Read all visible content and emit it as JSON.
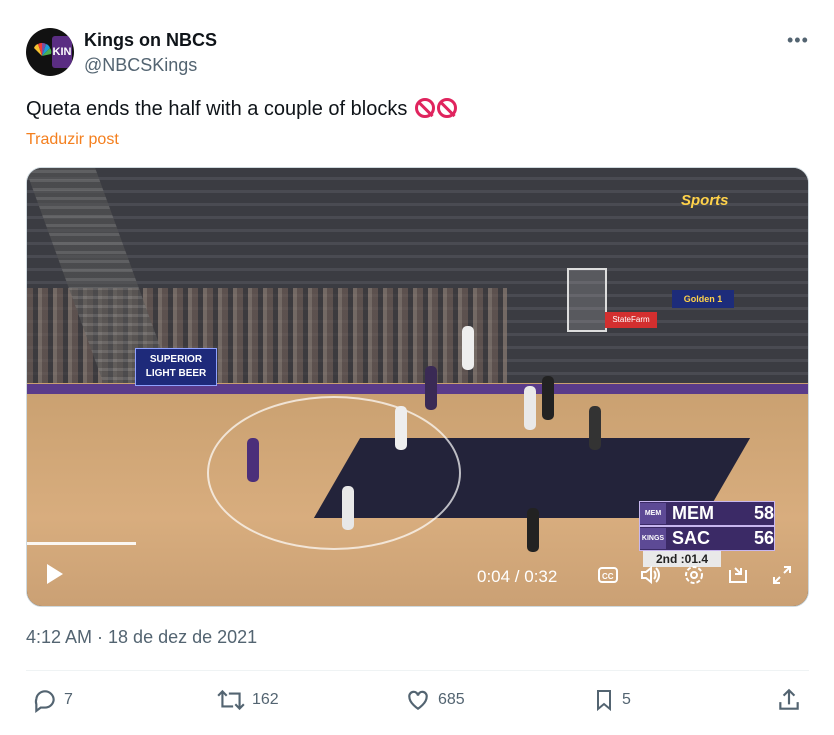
{
  "author": {
    "name": "Kings on NBCS",
    "handle": "@NBCSKings",
    "avatar_text": "KIN"
  },
  "post": {
    "text": "Queta ends the half with a couple of blocks",
    "emoji": [
      "🚫",
      "🚫"
    ],
    "translate_label": "Traduzir post",
    "timestamp": "4:12 AM · 18 de dez de 2021"
  },
  "video": {
    "current_time": "0:04",
    "duration": "0:32",
    "time_label": "0:04 / 0:32",
    "progress": 0.14,
    "broadcaster": "Sports",
    "arena_sign": "SUPERIOR LIGHT BEER",
    "golden_sign": "Golden 1",
    "sf_sign": "StateFarm",
    "scoreboard": {
      "teams": [
        {
          "abbr": "MEM",
          "score": "58",
          "logo": "MEM"
        },
        {
          "abbr": "SAC",
          "score": "56",
          "logo": "KINGS"
        }
      ],
      "period": "2nd :01.4"
    }
  },
  "actions": {
    "reply_count": "7",
    "repost_count": "162",
    "like_count": "685",
    "bookmark_count": "5"
  },
  "colors": {
    "accent_orange": "#f47f1e",
    "muted": "#536471",
    "kings_purple": "#5a2d82"
  }
}
